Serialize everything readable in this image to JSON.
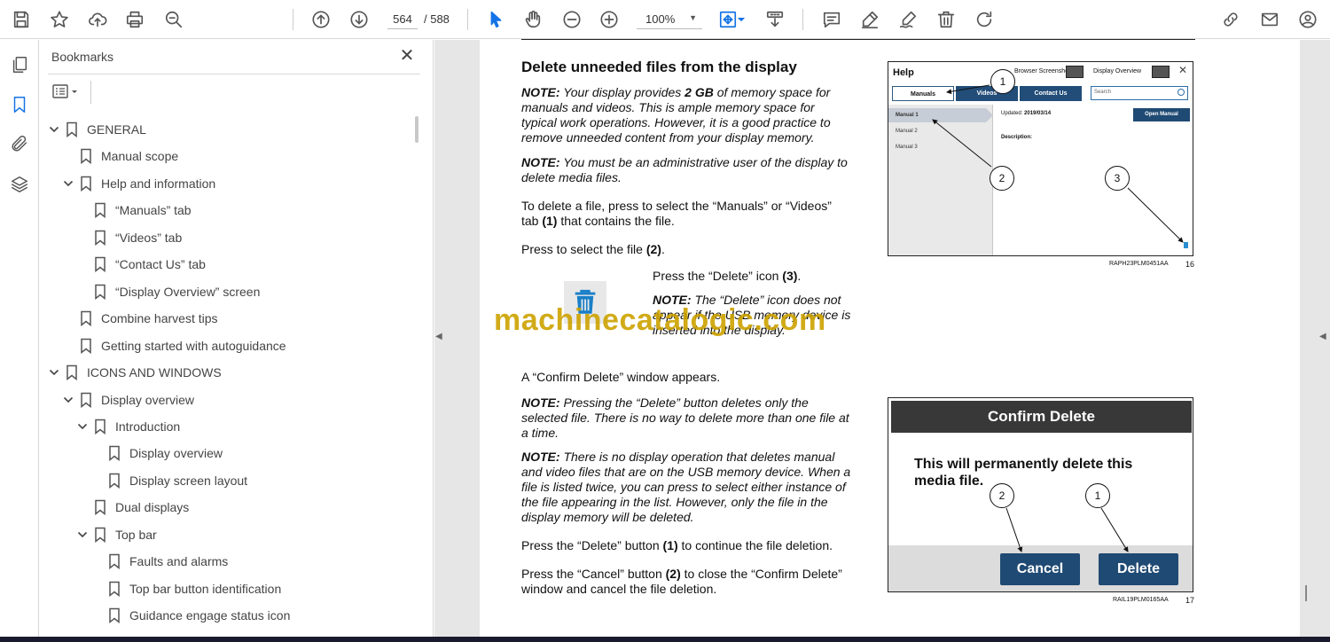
{
  "toolbar": {
    "page_current": "564",
    "page_total": "/ 588",
    "zoom": "100%"
  },
  "bookmarks": {
    "title": "Bookmarks",
    "close": "✕",
    "items": [
      {
        "label": "GENERAL",
        "level": 0,
        "expanded": true
      },
      {
        "label": "Manual scope",
        "level": 1,
        "expanded": null
      },
      {
        "label": "Help and information",
        "level": 1,
        "expanded": true
      },
      {
        "label": "“Manuals” tab",
        "level": 2,
        "expanded": null
      },
      {
        "label": "“Videos” tab",
        "level": 2,
        "expanded": null
      },
      {
        "label": "“Contact Us” tab",
        "level": 2,
        "expanded": null
      },
      {
        "label": "“Display Overview” screen",
        "level": 2,
        "expanded": null
      },
      {
        "label": "Combine harvest tips",
        "level": 1,
        "expanded": null
      },
      {
        "label": "Getting started with autoguidance",
        "level": 1,
        "expanded": null
      },
      {
        "label": "ICONS AND WINDOWS",
        "level": 0,
        "expanded": true
      },
      {
        "label": "Display overview",
        "level": 1,
        "expanded": true
      },
      {
        "label": "Introduction",
        "level": 2,
        "expanded": true
      },
      {
        "label": "Display overview",
        "level": 3,
        "expanded": null
      },
      {
        "label": "Display screen layout",
        "level": 3,
        "expanded": null
      },
      {
        "label": "Dual displays",
        "level": 2,
        "expanded": null
      },
      {
        "label": "Top bar",
        "level": 2,
        "expanded": true
      },
      {
        "label": "Faults and alarms",
        "level": 3,
        "expanded": null
      },
      {
        "label": "Top bar button identification",
        "level": 3,
        "expanded": null
      },
      {
        "label": "Guidance engage status icon",
        "level": 3,
        "expanded": null
      }
    ]
  },
  "document": {
    "title": "Delete unneeded files from the display",
    "p1_label": "NOTE:",
    "p1_a": " Your display provides ",
    "p1_bold": "2 GB",
    "p1_b": " of memory space for manuals and videos.  This is ample memory space for typical work operations.  However, it is a good practice to remove unneeded content from your display memory.",
    "p2_label": "NOTE:",
    "p2_text": " You must be an administrative user of the display to delete media files.",
    "p3_a": "To delete a file, press to select the “Manuals” or “Videos” tab ",
    "p3_bold": "(1)",
    "p3_b": " that contains the file.",
    "p4_a": "Press to select the file ",
    "p4_bold": "(2)",
    "p4_b": ".",
    "p5_a": "Press the “Delete” icon ",
    "p5_bold": "(3)",
    "p5_b": ".",
    "p6_label": "NOTE:",
    "p6_text": " The “Delete” icon does not appear if the USB memory device is inserted into the display.",
    "p7": "A “Confirm Delete” window appears.",
    "p8_label": "NOTE:",
    "p8_text": " Pressing the “Delete” button deletes only the selected file. There is no way to delete more than one file at a time.",
    "p9_label": "NOTE:",
    "p9_text": " There is no display operation that deletes manual and video files that are on the USB memory device.  When a file is listed twice, you can press to select either instance of the file appearing in the list.  However, only the file in the display memory will be deleted.",
    "p10_a": "Press the “Delete” button ",
    "p10_bold": "(1)",
    "p10_b": " to continue the file deletion.",
    "p11_a": "Press the “Cancel” button ",
    "p11_bold": "(2)",
    "p11_b": " to close the “Confirm Delete” window and cancel the file deletion."
  },
  "figure16": {
    "help": "Help",
    "browser_screenshot": "Browser Screenshot",
    "display_overview": "Display Overview",
    "close": "✕",
    "tab_manuals": "Manuals",
    "tab_videos": "Videos",
    "tab_contact": "Contact Us",
    "search": "Search",
    "manuals": [
      "Manual 1",
      "Manual 2",
      "Manual 3"
    ],
    "updated_label": "Updated:",
    "updated_value": "2019/03/14",
    "description": "Description:",
    "open_manual": "Open Manual",
    "callouts": [
      "1",
      "2",
      "3"
    ],
    "caption": "RAPH23PLM0451AA",
    "number": "16"
  },
  "figure17": {
    "header": "Confirm Delete",
    "message": "This will permanently delete this media file.",
    "cancel": "Cancel",
    "delete": "Delete",
    "callouts": [
      "2",
      "1"
    ],
    "caption": "RAIL19PLM0165AA",
    "number": "17"
  },
  "watermark": "machinecatalogic.com"
}
